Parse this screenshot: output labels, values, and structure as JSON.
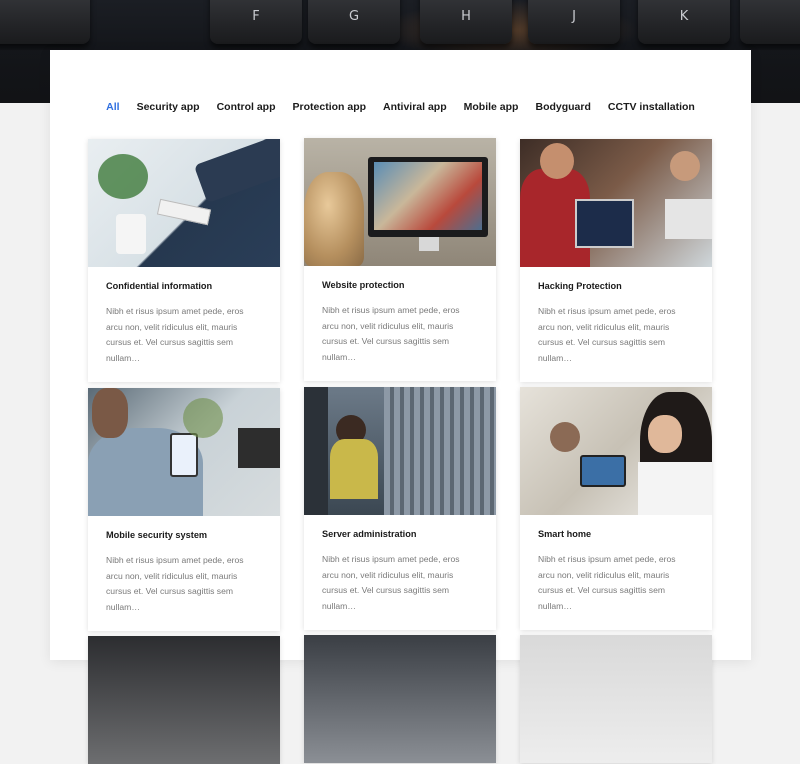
{
  "hero": {
    "keys": [
      "F",
      "G",
      "H",
      "J",
      "K"
    ]
  },
  "filters": [
    {
      "label": "All",
      "active": true
    },
    {
      "label": "Security app",
      "active": false
    },
    {
      "label": "Control app",
      "active": false
    },
    {
      "label": "Protection app",
      "active": false
    },
    {
      "label": "Antiviral app",
      "active": false
    },
    {
      "label": "Mobile app",
      "active": false
    },
    {
      "label": "Bodyguard",
      "active": false
    },
    {
      "label": "CCTV installation",
      "active": false
    }
  ],
  "cards": [
    {
      "title": "Confidential information",
      "excerpt": "Nibh et risus ipsum amet pede, eros arcu non, velit ridiculus elit, mauris cursus et. Vel cursus sagittis sem nullam…"
    },
    {
      "title": "Website protection",
      "excerpt": "Nibh et risus ipsum amet pede, eros arcu non, velit ridiculus elit, mauris cursus et. Vel cursus sagittis sem nullam…"
    },
    {
      "title": "Hacking Protection",
      "excerpt": "Nibh et risus ipsum amet pede, eros arcu non, velit ridiculus elit, mauris cursus et. Vel cursus sagittis sem nullam…"
    },
    {
      "title": "Mobile security system",
      "excerpt": "Nibh et risus ipsum amet pede, eros arcu non, velit ridiculus elit, mauris cursus et. Vel cursus sagittis sem nullam…"
    },
    {
      "title": "Server administration",
      "excerpt": "Nibh et risus ipsum amet pede, eros arcu non, velit ridiculus elit, mauris cursus et. Vel cursus sagittis sem nullam…"
    },
    {
      "title": "Smart home",
      "excerpt": "Nibh et risus ipsum amet pede, eros arcu non, velit ridiculus elit, mauris cursus et. Vel cursus sagittis sem nullam…"
    }
  ],
  "colors": {
    "accent": "#2f6fe0",
    "heading": "#1b1b1b",
    "body_text": "#7a7a7a",
    "page_bg": "#f2f2f2",
    "card_bg": "#ffffff"
  },
  "icons": {
    "thumb_icons": [
      "smartwatch-payment-photo",
      "monitor-website-photo",
      "laptops-hackers-photo",
      "phone-user-photo",
      "server-room-photo",
      "tablet-smart-home-photo"
    ]
  }
}
